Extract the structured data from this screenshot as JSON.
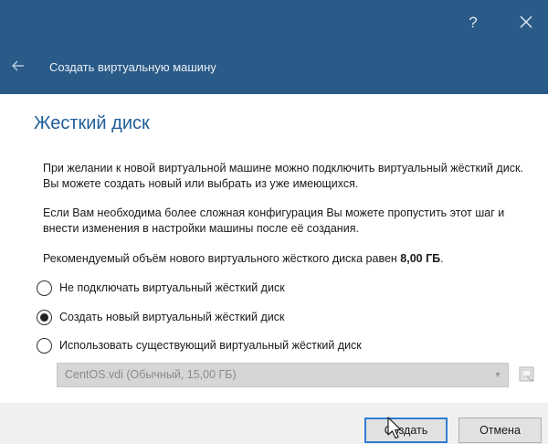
{
  "window": {
    "help_label": "?",
    "wizard_title": "Создать виртуальную машину"
  },
  "page": {
    "heading": "Жесткий диск",
    "para1": "При желании к новой виртуальной машине можно подключить виртуальный жёсткий диск. Вы можете создать новый или выбрать из уже имеющихся.",
    "para2": "Если Вам необходима более сложная конфигурация Вы можете пропустить этот шаг и внести изменения в настройки машины после её создания.",
    "para3_text": "Рекомендуемый объём нового виртуального жёсткого диска равен ",
    "para3_size": "8,00 ГБ",
    "para3_end": "."
  },
  "options": [
    {
      "label": "Не подключать виртуальный жёсткий диск",
      "selected": false
    },
    {
      "label": "Создать новый виртуальный жёсткий диск",
      "selected": true
    },
    {
      "label": "Использовать существующий виртуальный жёсткий диск",
      "selected": false
    }
  ],
  "disk_select": {
    "value": "CentOS.vdi (Обычный, 15,00 ГБ)",
    "enabled": false
  },
  "buttons": {
    "create": "Создать",
    "cancel": "Отмена"
  },
  "colors": {
    "titlebar": "#2a5a87",
    "heading": "#1f5d98",
    "default_button_border": "#2e7cd4"
  }
}
